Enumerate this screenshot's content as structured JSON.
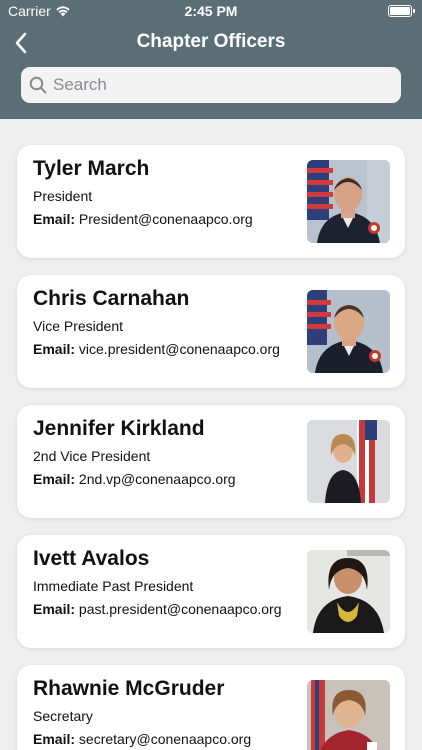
{
  "status": {
    "carrier": "Carrier",
    "time": "2:45 PM"
  },
  "nav": {
    "title": "Chapter Officers"
  },
  "search": {
    "placeholder": "Search"
  },
  "officers": [
    {
      "name": "Tyler March",
      "role": "President",
      "email_label": "Email:",
      "email": "President@conenaapco.org"
    },
    {
      "name": "Chris Carnahan",
      "role": "Vice President",
      "email_label": "Email:",
      "email": "vice.president@conenaapco.org"
    },
    {
      "name": "Jennifer Kirkland",
      "role": "2nd Vice President",
      "email_label": "Email:",
      "email": "2nd.vp@conenaapco.org"
    },
    {
      "name": "Ivett Avalos",
      "role": "Immediate Past President",
      "email_label": "Email:",
      "email": "past.president@conenaapco.org"
    },
    {
      "name": "Rhawnie McGruder",
      "role": "Secretary",
      "email_label": "Email:",
      "email": "secretary@conenaapco.org"
    }
  ],
  "colors": {
    "header": "#5b6e76",
    "background": "#efefef",
    "card": "#ffffff"
  }
}
